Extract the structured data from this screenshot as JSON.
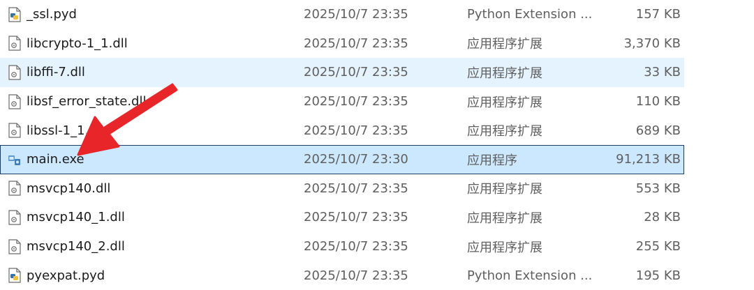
{
  "files": [
    {
      "name": "_ssl.pyd",
      "date": "2025/10/7 23:35",
      "type": "Python Extension ...",
      "size": "157 KB",
      "icon": "python-file-icon",
      "state": ""
    },
    {
      "name": "libcrypto-1_1.dll",
      "date": "2025/10/7 23:35",
      "type": "应用程序扩展",
      "size": "3,370 KB",
      "icon": "dll-file-icon",
      "state": ""
    },
    {
      "name": "libffi-7.dll",
      "date": "2025/10/7 23:35",
      "type": "应用程序扩展",
      "size": "33 KB",
      "icon": "dll-file-icon",
      "state": "hover"
    },
    {
      "name": "libsf_error_state.dll",
      "date": "2025/10/7 23:35",
      "type": "应用程序扩展",
      "size": "110 KB",
      "icon": "dll-file-icon",
      "state": ""
    },
    {
      "name": "libssl-1_1.dll",
      "date": "2025/10/7 23:35",
      "type": "应用程序扩展",
      "size": "689 KB",
      "icon": "dll-file-icon",
      "state": ""
    },
    {
      "name": "main.exe",
      "date": "2025/10/7 23:30",
      "type": "应用程序",
      "size": "91,213 KB",
      "icon": "exe-file-icon",
      "state": "selected"
    },
    {
      "name": "msvcp140.dll",
      "date": "2025/10/7 23:35",
      "type": "应用程序扩展",
      "size": "553 KB",
      "icon": "dll-file-icon",
      "state": ""
    },
    {
      "name": "msvcp140_1.dll",
      "date": "2025/10/7 23:35",
      "type": "应用程序扩展",
      "size": "28 KB",
      "icon": "dll-file-icon",
      "state": ""
    },
    {
      "name": "msvcp140_2.dll",
      "date": "2025/10/7 23:35",
      "type": "应用程序扩展",
      "size": "255 KB",
      "icon": "dll-file-icon",
      "state": ""
    },
    {
      "name": "pyexpat.pyd",
      "date": "2025/10/7 23:35",
      "type": "Python Extension ...",
      "size": "195 KB",
      "icon": "python-file-icon",
      "state": ""
    }
  ],
  "colors": {
    "hover_bg": "#e5f3ff",
    "selected_bg": "#cce8ff",
    "selected_border": "#1a3c6b",
    "arrow": "#e8262a"
  }
}
